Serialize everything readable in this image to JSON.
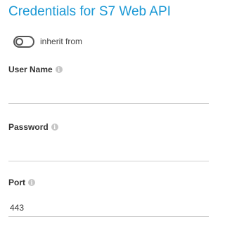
{
  "header": {
    "title": "Credentials for S7 Web API"
  },
  "inherit": {
    "label": "inherit from",
    "enabled": false
  },
  "fields": {
    "username": {
      "label": "User Name",
      "value": "",
      "placeholder": ""
    },
    "password": {
      "label": "Password",
      "value": "",
      "placeholder": ""
    },
    "port": {
      "label": "Port",
      "value": "443",
      "placeholder": ""
    }
  },
  "icons": {
    "info": "info-icon",
    "toggle": "toggle-switch"
  },
  "colors": {
    "title": "#1a98d5",
    "divider": "#cfcfcf",
    "info_icon": "#c6c6c6"
  }
}
